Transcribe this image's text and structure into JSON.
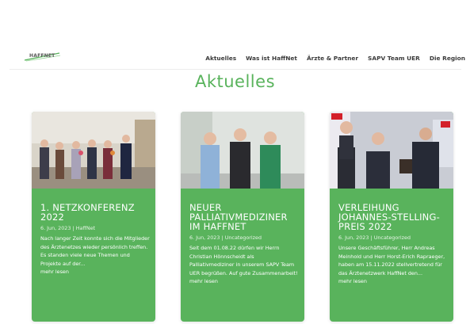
{
  "header": {
    "logo_text": "HAFFNET",
    "nav": [
      {
        "label": "Aktuelles"
      },
      {
        "label": "Was ist HaffNet"
      },
      {
        "label": "Ärzte & Partner"
      },
      {
        "label": "SAPV Team UER"
      },
      {
        "label": "Die Region"
      }
    ]
  },
  "main": {
    "title": "Aktuelles",
    "posts": [
      {
        "title": "1. NETZKONFERENZ 2022",
        "date": "6. Jun, 2023",
        "separator": "|",
        "category": "HaffNet",
        "excerpt": "Nach langer Zeit konnte sich die Mitglieder des Ärztenetzes wieder persönlich treffen. Es standen viele neue Themen und Projekte auf der...",
        "more": "mehr lesen"
      },
      {
        "title": "NEUER PALLIATIVMEDIZINER IM HAFFNET",
        "date": "6. Jun, 2023",
        "separator": "|",
        "category": "Uncategorized",
        "excerpt": "Seit dem 01.08.22 dürfen wir Herrn Christian Hönnscheidt als Palliativmediziner in unserem SAPV Team UER begrüßen. Auf gute Zusammenarbeit!",
        "more": "mehr lesen"
      },
      {
        "title": "VERLEIHUNG JOHANNES-STELLING-PREIS 2022",
        "date": "6. Jun, 2023",
        "separator": "|",
        "category": "Uncategorized",
        "excerpt": "Unsere Geschäftsführer, Herr Andreas Meinhold und Herr Horst-Erich Rapraeger, haben am 15.11.2022 stellvertretend für das Ärztenetzwerk HaffNet den...",
        "more": "mehr lesen"
      }
    ]
  },
  "colors": {
    "accent": "#59b35c",
    "nav_text": "#3b3b3b"
  }
}
